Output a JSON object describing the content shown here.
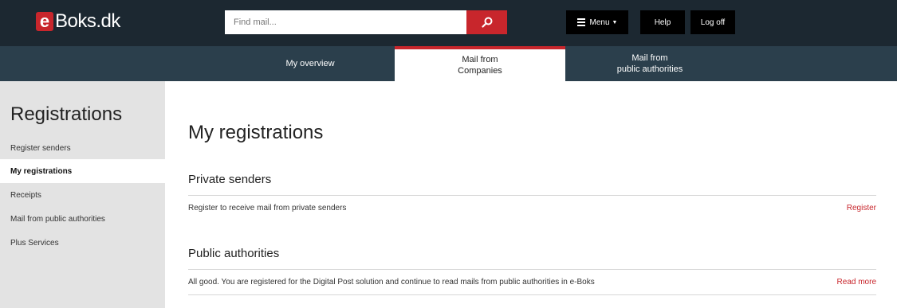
{
  "header": {
    "logo_e": "e",
    "logo_rest": "Boks.dk",
    "search_placeholder": "Find mail...",
    "menu_label": "Menu",
    "help_label": "Help",
    "logoff_label": "Log off"
  },
  "nav": {
    "tabs": [
      {
        "label": "My overview"
      },
      {
        "label": "Mail from\nCompanies"
      },
      {
        "label": "Mail from\npublic authorities"
      }
    ]
  },
  "sidebar": {
    "title": "Registrations",
    "items": [
      {
        "label": "Register senders"
      },
      {
        "label": "My registrations"
      },
      {
        "label": "Receipts"
      },
      {
        "label": "Mail from public authorities"
      },
      {
        "label": "Plus Services"
      }
    ]
  },
  "main": {
    "title": "My registrations",
    "sections": [
      {
        "title": "Private senders",
        "text": "Register to receive mail from private senders",
        "link": "Register"
      },
      {
        "title": "Public authorities",
        "text": "All good. You are registered for the Digital Post solution and continue to read mails from public authorities in e-Boks",
        "link": "Read more"
      }
    ]
  },
  "colors": {
    "brand_red": "#c8262c",
    "header_bg": "#1c2831",
    "nav_bg": "#2b3f4c",
    "sidebar_bg": "#e3e3e3"
  }
}
